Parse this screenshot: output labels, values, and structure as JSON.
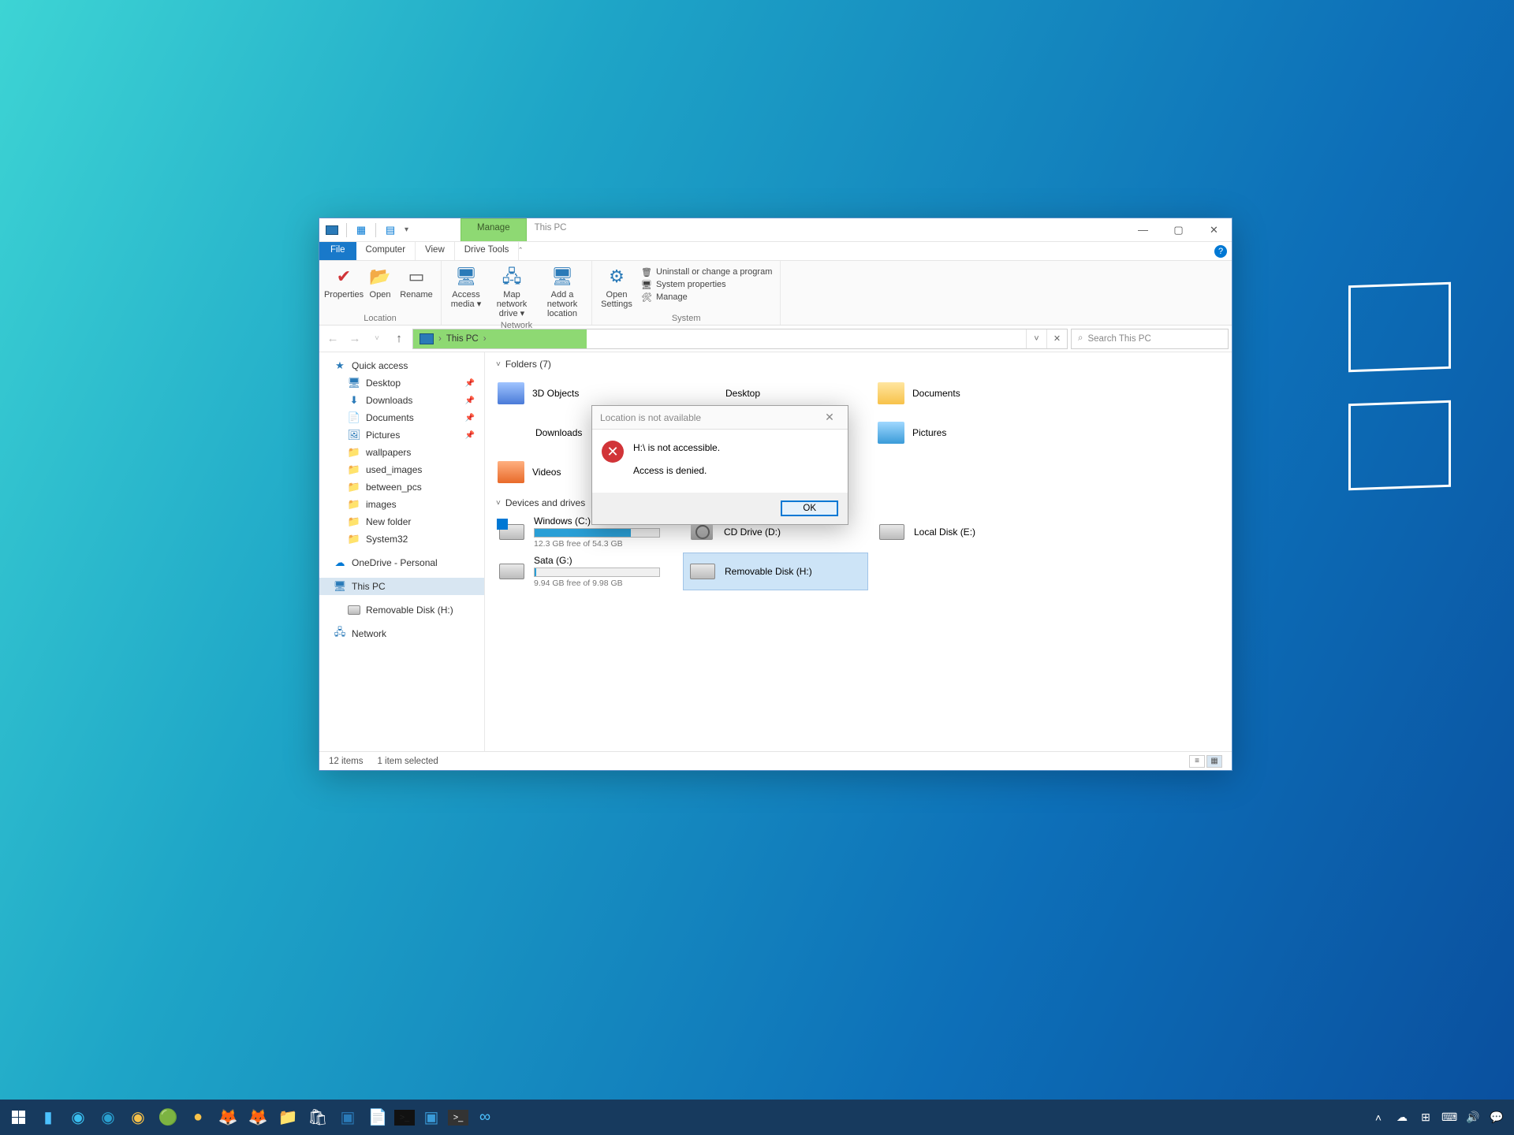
{
  "window": {
    "title": "This PC",
    "manage_tab": "Manage",
    "menu": {
      "file": "File",
      "computer": "Computer",
      "view": "View",
      "drive_tools": "Drive Tools"
    },
    "ribbon": {
      "location_group": "Location",
      "properties": "Properties",
      "open": "Open",
      "rename": "Rename",
      "network_group": "Network",
      "access_media": "Access media ▾",
      "map_drive": "Map network drive ▾",
      "add_location": "Add a network location",
      "open_settings": "Open Settings",
      "system_group": "System",
      "uninstall": "Uninstall or change a program",
      "sys_props": "System properties",
      "manage": "Manage"
    },
    "address": {
      "location": "This PC",
      "chevron": "›"
    },
    "search_placeholder": "Search This PC",
    "status": {
      "items": "12 items",
      "selected": "1 item selected"
    }
  },
  "nav": {
    "quick_access": "Quick access",
    "items": [
      {
        "label": "Desktop",
        "icon": "desk"
      },
      {
        "label": "Downloads",
        "icon": "dl"
      },
      {
        "label": "Documents",
        "icon": "docs"
      },
      {
        "label": "Pictures",
        "icon": "pic"
      },
      {
        "label": "wallpapers",
        "icon": "fold"
      },
      {
        "label": "used_images",
        "icon": "fold"
      },
      {
        "label": "between_pcs",
        "icon": "fold"
      },
      {
        "label": "images",
        "icon": "fold"
      },
      {
        "label": "New folder",
        "icon": "fold"
      },
      {
        "label": "System32",
        "icon": "fold"
      }
    ],
    "onedrive": "OneDrive - Personal",
    "this_pc": "This PC",
    "removable": "Removable Disk (H:)",
    "network": "Network"
  },
  "content": {
    "folders_header": "Folders (7)",
    "folders": [
      {
        "name": "3D Objects"
      },
      {
        "name": "Desktop"
      },
      {
        "name": "Documents"
      },
      {
        "name": "Downloads"
      },
      {
        "name": ""
      },
      {
        "name": "Pictures"
      },
      {
        "name": "Videos"
      }
    ],
    "drives_header": "Devices and drives",
    "drives": [
      {
        "name": "Windows (C:)",
        "free": "12.3 GB free of 54.3 GB",
        "fill": 77,
        "type": "win"
      },
      {
        "name": "CD Drive (D:)",
        "free": "",
        "fill": -1,
        "type": "cd"
      },
      {
        "name": "Local Disk (E:)",
        "free": "",
        "fill": -1,
        "type": "hdd"
      },
      {
        "name": "Sata (G:)",
        "free": "9.94 GB free of 9.98 GB",
        "fill": 1,
        "type": "hdd"
      },
      {
        "name": "Removable Disk (H:)",
        "free": "",
        "fill": -1,
        "type": "hdd",
        "selected": true
      }
    ]
  },
  "dialog": {
    "title": "Location is not available",
    "line1": "H:\\ is not accessible.",
    "line2": "Access is denied.",
    "ok": "OK"
  },
  "taskbar": {
    "tray": [
      "˄",
      "☁",
      "⊞",
      "⌨",
      "🔊",
      "💬"
    ]
  }
}
